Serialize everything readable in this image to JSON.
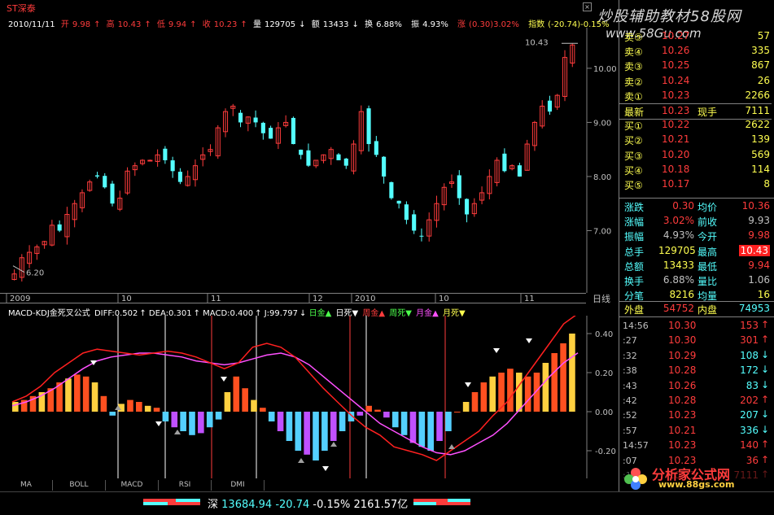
{
  "stock": {
    "name": "ST深泰",
    "date": "2010/11/11"
  },
  "watermark": {
    "top": "炒股辅助教材58股网",
    "url": "www.58Gu.com",
    "bottom_brand": "分析家公式网",
    "bottom_url": "www.88gs.com"
  },
  "quote": {
    "open_label": "开",
    "open": "9.98",
    "high_label": "高",
    "high": "10.43",
    "low_label": "低",
    "low": "9.94",
    "close_label": "收",
    "close": "10.23",
    "vol_label": "量",
    "vol": "129705",
    "amt_label": "额",
    "amt": "13433",
    "turn_label": "换",
    "turn": "6.88%",
    "amp_label": "振",
    "amp": "4.93%",
    "chg_label": "涨",
    "chg": "(0.30)3.02%",
    "index_label": "指数",
    "index": "(-20.74)-0.15%"
  },
  "price_axis": {
    "labels": [
      "10.00",
      "9.00",
      "8.00",
      "7.00"
    ],
    "hi_mark": "10.43",
    "lo_mark": "6.20"
  },
  "time_axis": {
    "labels": [
      "2009",
      "10",
      "11",
      "12",
      "2010",
      "10",
      "11"
    ],
    "period": "日线"
  },
  "macd": {
    "title": "MACD-KDJ金死叉公式",
    "diff": "DIFF:0.502",
    "dea": "DEA:0.301",
    "macd": "MACD:0.400",
    "j": "J:99.797",
    "signals": [
      "日金▲",
      "日死▼",
      "周金▲",
      "周死▼",
      "月金▲",
      "月死▼"
    ],
    "axis": [
      "0.40",
      "0.20",
      "0.00",
      "-0.20"
    ]
  },
  "tabs": [
    "MA",
    "BOLL",
    "MACD",
    "RSI",
    "DMI"
  ],
  "status": {
    "market": "深",
    "index": "13684.94",
    "change": "-20.74",
    "pct": "-0.15%",
    "amount": "2161.57亿"
  },
  "orderbook": {
    "sells": [
      {
        "label": "卖⑤",
        "price": "10.27",
        "vol": "57"
      },
      {
        "label": "卖④",
        "price": "10.26",
        "vol": "335"
      },
      {
        "label": "卖③",
        "price": "10.25",
        "vol": "867"
      },
      {
        "label": "卖②",
        "price": "10.24",
        "vol": "26"
      },
      {
        "label": "卖①",
        "price": "10.23",
        "vol": "2266"
      }
    ],
    "last": {
      "label": "最新",
      "price": "10.23",
      "cur_label": "现手",
      "cur": "7111"
    },
    "buys": [
      {
        "label": "买①",
        "price": "10.22",
        "vol": "2622"
      },
      {
        "label": "买②",
        "price": "10.21",
        "vol": "139"
      },
      {
        "label": "买③",
        "price": "10.20",
        "vol": "569"
      },
      {
        "label": "买④",
        "price": "10.18",
        "vol": "114"
      },
      {
        "label": "买⑤",
        "price": "10.17",
        "vol": "8"
      }
    ]
  },
  "stats": [
    {
      "k1": "涨跌",
      "v1": "0.30",
      "k2": "均价",
      "v2": "10.36"
    },
    {
      "k1": "涨幅",
      "v1": "3.02%",
      "k2": "前收",
      "v2": "9.93"
    },
    {
      "k1": "振幅",
      "v1": "4.93%",
      "k2": "今开",
      "v2": "9.98"
    },
    {
      "k1": "总手",
      "v1": "129705",
      "k2": "最高",
      "v2": "10.43"
    },
    {
      "k1": "总额",
      "v1": "13433",
      "k2": "最低",
      "v2": "9.94"
    },
    {
      "k1": "换手",
      "v1": "6.88%",
      "k2": "量比",
      "v2": "1.06"
    },
    {
      "k1": "分笔",
      "v1": "8216",
      "k2": "均量",
      "v2": "16"
    }
  ],
  "outer": {
    "out_label": "外盘",
    "out": "54752",
    "in_label": "内盘",
    "in": "74953"
  },
  "ticks": [
    {
      "t": "14:56",
      "p": "10.30",
      "v": "153",
      "d": "up"
    },
    {
      "t": ":27",
      "p": "10.30",
      "v": "301",
      "d": "up"
    },
    {
      "t": ":32",
      "p": "10.29",
      "v": "108",
      "d": "down"
    },
    {
      "t": ":38",
      "p": "10.28",
      "v": "172",
      "d": "down"
    },
    {
      "t": ":43",
      "p": "10.26",
      "v": "83",
      "d": "down"
    },
    {
      "t": ":42",
      "p": "10.28",
      "v": "202",
      "d": "up"
    },
    {
      "t": ":52",
      "p": "10.23",
      "v": "207",
      "d": "down"
    },
    {
      "t": ":57",
      "p": "10.21",
      "v": "336",
      "d": "down"
    },
    {
      "t": "14:57",
      "p": "10.23",
      "v": "140",
      "d": "up"
    },
    {
      "t": ":07",
      "p": "10.23",
      "v": "36",
      "d": "up"
    },
    {
      "t": ":12",
      "p": "10.23",
      "v": "7111",
      "d": "up"
    }
  ],
  "chart_data": [
    {
      "type": "candlestick",
      "title": "ST深泰",
      "ylim": [
        6.0,
        10.6
      ],
      "x_ticks": [
        "2009",
        "10",
        "11",
        "12",
        "2010",
        "10",
        "11"
      ],
      "close_path": [
        6.2,
        6.5,
        6.6,
        6.7,
        6.8,
        7.1,
        7.0,
        7.3,
        7.5,
        7.7,
        7.9,
        8.0,
        7.8,
        7.5,
        7.6,
        8.1,
        8.2,
        8.3,
        8.3,
        8.4,
        8.3,
        8.1,
        7.9,
        8.0,
        8.2,
        8.4,
        8.5,
        8.9,
        9.2,
        9.3,
        9.0,
        9.1,
        9.0,
        8.8,
        8.7,
        8.9,
        9.0,
        8.6,
        8.4,
        8.2,
        8.3,
        8.4,
        8.5,
        8.3,
        8.2,
        8.6,
        9.2,
        8.6,
        8.4,
        8.0,
        7.6,
        7.5,
        7.2,
        7.0,
        6.9,
        7.2,
        7.5,
        7.8,
        7.9,
        7.6,
        7.3,
        7.5,
        7.7,
        8.0,
        8.3,
        8.1,
        8.2,
        8.0,
        8.6,
        9.0,
        9.3,
        9.2,
        9.5,
        10.2,
        10.43
      ],
      "low": 6.2,
      "high": 10.43
    },
    {
      "type": "bar",
      "title": "MACD-KDJ金死叉公式",
      "ylim": [
        -0.3,
        0.45
      ],
      "macd_hist": [
        0.05,
        0.06,
        0.08,
        0.1,
        0.12,
        0.15,
        0.17,
        0.19,
        0.18,
        0.15,
        0.08,
        -0.02,
        0.04,
        0.06,
        0.05,
        0.03,
        0.02,
        -0.05,
        -0.08,
        -0.1,
        -0.12,
        -0.11,
        -0.08,
        -0.04,
        0.1,
        0.18,
        0.12,
        0.06,
        0.02,
        -0.05,
        -0.1,
        -0.15,
        -0.2,
        -0.22,
        -0.25,
        -0.2,
        -0.15,
        -0.1,
        -0.05,
        -0.02,
        0.03,
        0.01,
        -0.03,
        -0.08,
        -0.12,
        -0.16,
        -0.18,
        -0.2,
        -0.15,
        -0.1,
        0.0,
        0.05,
        0.1,
        0.15,
        0.18,
        0.2,
        0.22,
        0.2,
        0.18,
        0.2,
        0.25,
        0.3,
        0.35,
        0.4
      ],
      "diff": [
        0.05,
        0.08,
        0.13,
        0.2,
        0.25,
        0.3,
        0.32,
        0.31,
        0.3,
        0.29,
        0.3,
        0.31,
        0.3,
        0.28,
        0.25,
        0.22,
        0.25,
        0.33,
        0.35,
        0.33,
        0.28,
        0.2,
        0.12,
        0.05,
        -0.02,
        -0.08,
        -0.12,
        -0.18,
        -0.2,
        -0.22,
        -0.25,
        -0.2,
        -0.15,
        -0.1,
        -0.02,
        0.05,
        0.15,
        0.25,
        0.35,
        0.45,
        0.502
      ],
      "dea": [
        0.03,
        0.05,
        0.08,
        0.12,
        0.17,
        0.22,
        0.26,
        0.28,
        0.29,
        0.3,
        0.3,
        0.29,
        0.28,
        0.26,
        0.25,
        0.24,
        0.25,
        0.27,
        0.29,
        0.3,
        0.28,
        0.24,
        0.18,
        0.12,
        0.06,
        0.0,
        -0.06,
        -0.1,
        -0.14,
        -0.18,
        -0.21,
        -0.22,
        -0.2,
        -0.16,
        -0.12,
        -0.06,
        0.02,
        0.1,
        0.18,
        0.25,
        0.301
      ]
    }
  ]
}
